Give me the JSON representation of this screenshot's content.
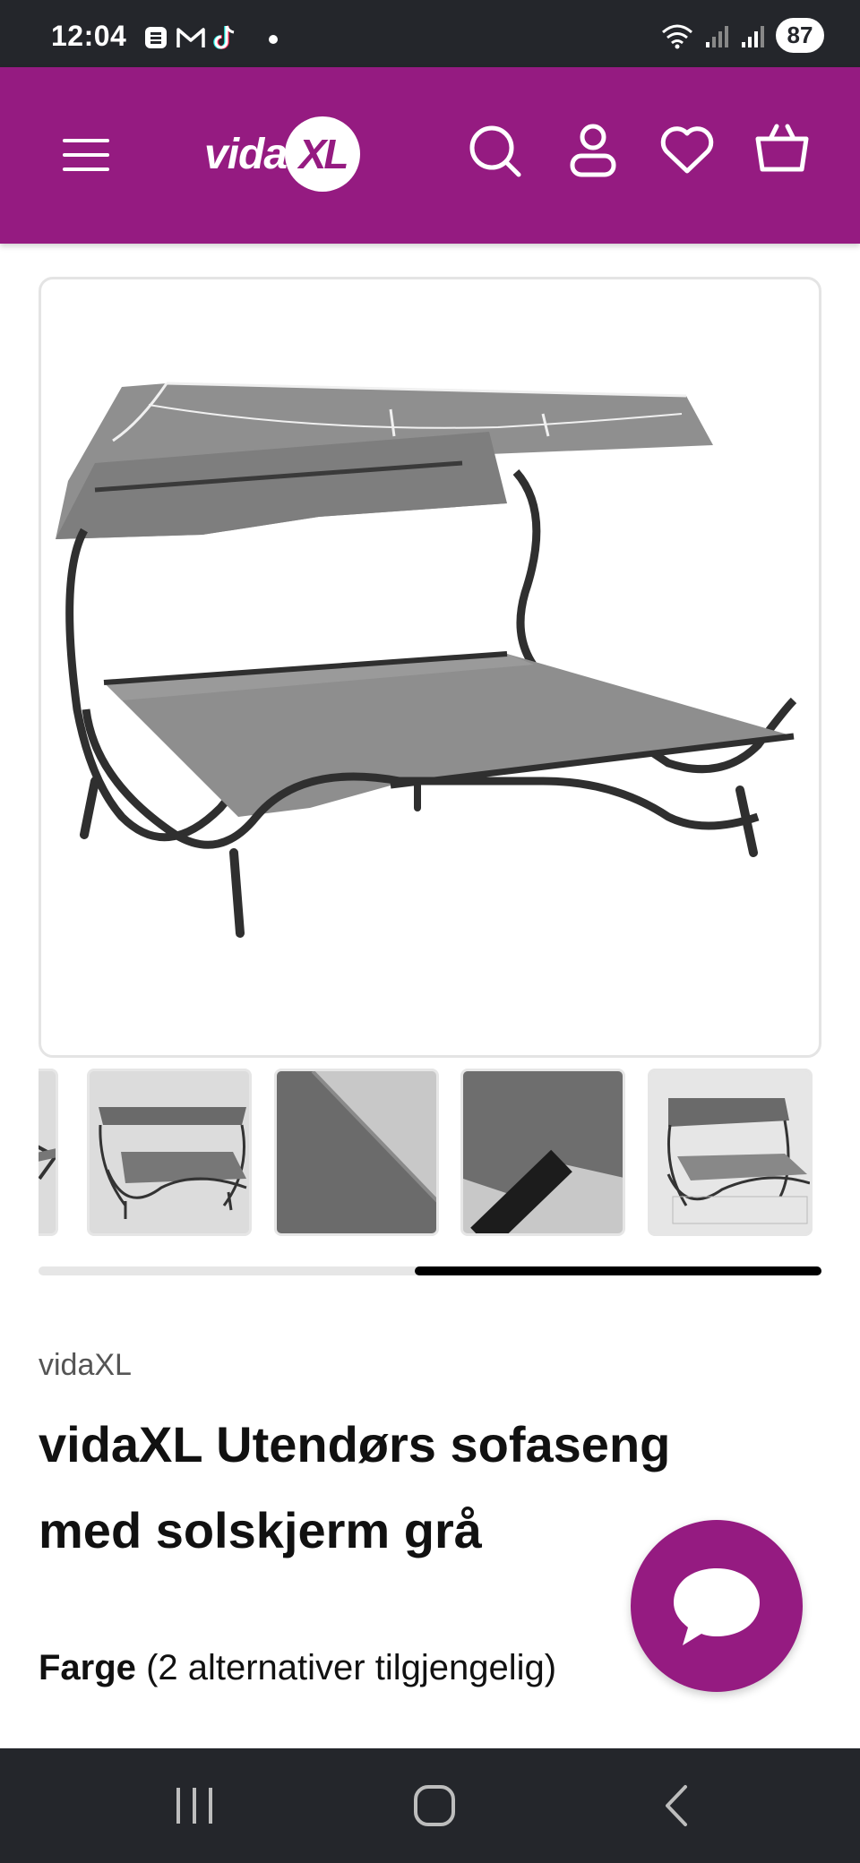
{
  "status_bar": {
    "time": "12:04",
    "battery": "87",
    "icons": [
      "notification-b-icon",
      "gmail-icon",
      "tiktok-icon",
      "wifi-icon",
      "signal-icon",
      "signal-r-icon"
    ]
  },
  "header": {
    "logo_text": "vida",
    "logo_badge": "XL",
    "icons": [
      "menu-icon",
      "search-icon",
      "account-icon",
      "wishlist-heart-icon",
      "cart-basket-icon"
    ],
    "brand_color": "#951b81"
  },
  "product": {
    "brand": "vidaXL",
    "title": "vidaXL Utendørs sofaseng med solskjerm grå",
    "color_label": "Farge",
    "color_options": "(2 alternativer tilgjengelig)",
    "gallery_progress": 0.52
  },
  "chat": {
    "icon": "chat-bubble-icon"
  },
  "nav_bar": {
    "icons": [
      "recent-apps-icon",
      "home-icon",
      "back-icon"
    ]
  }
}
